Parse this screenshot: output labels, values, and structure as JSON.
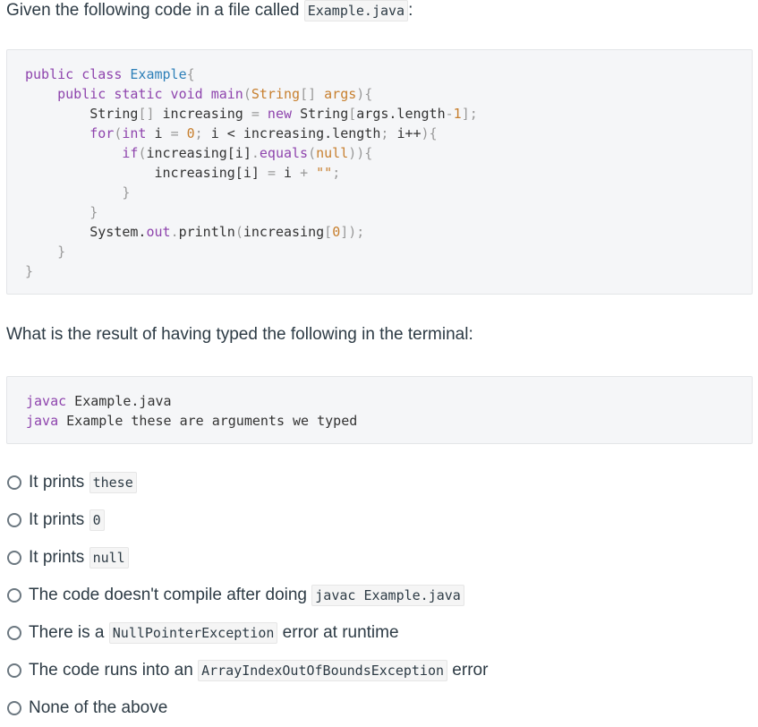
{
  "question": {
    "intro_text": "Given the following code in a file called",
    "intro_file": "Example.java",
    "intro_suffix": ":",
    "prompt": "What is the result of having typed the following in the terminal:"
  },
  "code": {
    "l1_kw": "public class",
    "l1_name": "Example",
    "l1_brace": "{",
    "l2_indent": "    ",
    "l2_kw": "public static void",
    "l2_fn": "main",
    "l2_paren_open": "(",
    "l2_type": "String",
    "l2_arr": "[]",
    "l2_arg": " args",
    "l2_close": "){",
    "l3_indent": "        ",
    "l3_type": "String",
    "l3_arr": "[]",
    "l3_var": " increasing ",
    "l3_eq": "=",
    "l3_new": " new ",
    "l3_type2": "String",
    "l3_br_open": "[",
    "l3_expr": "args.length",
    "l3_minus": "-",
    "l3_num": "1",
    "l3_end": "];",
    "l4_indent": "        ",
    "l4_for": "for",
    "l4_paren": "(",
    "l4_int": "int",
    "l4_i": " i ",
    "l4_eq": "=",
    "l4_zero": " 0",
    "l4_semi": "; ",
    "l4_cond": "i < increasing.length",
    "l4_semi2": "; ",
    "l4_inc": "i++",
    "l4_close": "){",
    "l5_indent": "            ",
    "l5_if": "if",
    "l5_paren": "(",
    "l5_expr": "increasing[i]",
    "l5_dot": ".",
    "l5_equals": "equals",
    "l5_p2": "(",
    "l5_null": "null",
    "l5_close": ")){",
    "l6_indent": "                ",
    "l6_expr": "increasing[i] ",
    "l6_eq": "=",
    "l6_i": " i ",
    "l6_plus": "+",
    "l6_str": " \"\"",
    "l6_semi": ";",
    "l7_indent": "            ",
    "l7_brace": "}",
    "l8_indent": "        ",
    "l8_brace": "}",
    "l9_indent": "        ",
    "l9_sys": "System.",
    "l9_out": "out",
    "l9_dot": ".",
    "l9_println": "println",
    "l9_paren": "(",
    "l9_expr": "increasing",
    "l9_br": "[",
    "l9_num": "0",
    "l9_end": "]);",
    "l10_indent": "    ",
    "l10_brace": "}",
    "l11_brace": "}"
  },
  "terminal": {
    "t1_cmd": "javac",
    "t1_arg": " Example.java",
    "t2_cmd": "java",
    "t2_arg": " Example these are arguments we typed"
  },
  "answers": {
    "a1_text": "It prints",
    "a1_code": "these",
    "a2_text": "It prints",
    "a2_code": "0",
    "a3_text": "It prints",
    "a3_code": "null",
    "a4_text": "The code doesn't compile after doing",
    "a4_code": "javac Example.java",
    "a5_pre": "There is a",
    "a5_code": "NullPointerException",
    "a5_post": "error at runtime",
    "a6_pre": "The code runs into an",
    "a6_code": "ArrayIndexOutOfBoundsException",
    "a6_post": "error",
    "a7_text": "None of the above"
  }
}
